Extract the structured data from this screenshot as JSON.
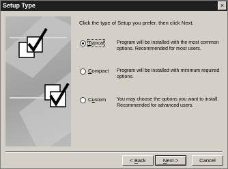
{
  "window": {
    "title": "Setup Type",
    "close_glyph": "×"
  },
  "side_panel": {
    "icons": [
      "checked-box-icon",
      "checked-box-icon"
    ]
  },
  "instruction": "Click the type of Setup you prefer, then click Next.",
  "options": [
    {
      "key": "typical",
      "label_ul": "T",
      "label_rest": "ypical",
      "description": "Program will be installed with the most common options.  Recommended for most users.",
      "selected": true
    },
    {
      "key": "compact",
      "label_ul": "C",
      "label_rest": "ompact",
      "description": "Program will be installed with minimum required options.",
      "selected": false
    },
    {
      "key": "custom",
      "label_ul": "u",
      "label_pre": "C",
      "label_rest": "stom",
      "description": "You may choose the options you want to install. Recommended for advanced users.",
      "selected": false
    }
  ],
  "buttons": {
    "back_prefix": "< ",
    "back_ul": "B",
    "back_rest": "ack",
    "next_ul": "N",
    "next_rest": "ext >",
    "cancel": "Cancel"
  }
}
